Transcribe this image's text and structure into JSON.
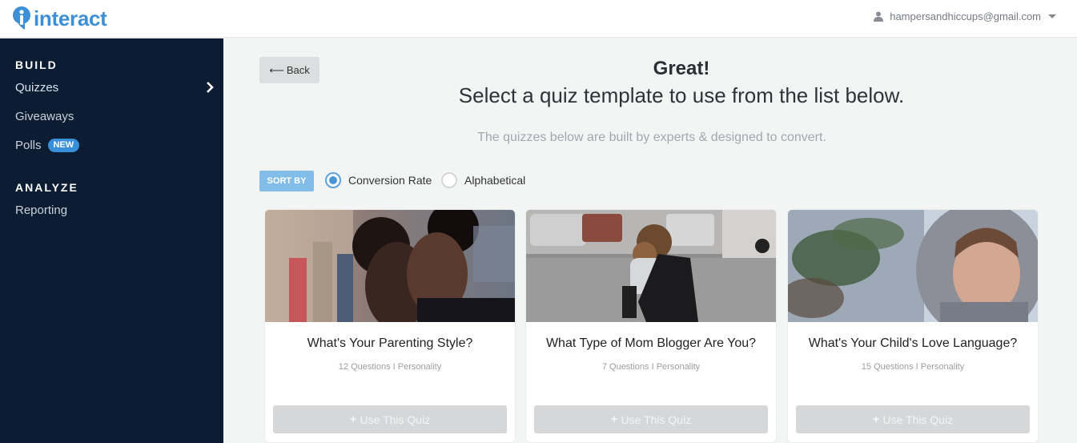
{
  "header": {
    "brand": "interact",
    "user_email": "hampersandhiccups@gmail.com"
  },
  "sidebar": {
    "sections": [
      {
        "heading": "BUILD",
        "items": [
          {
            "label": "Quizzes",
            "active": true
          },
          {
            "label": "Giveaways"
          },
          {
            "label": "Polls",
            "badge": "NEW"
          }
        ]
      },
      {
        "heading": "ANALYZE",
        "items": [
          {
            "label": "Reporting"
          }
        ]
      }
    ]
  },
  "main": {
    "back_label": "Back",
    "title": "Great!",
    "subtitle": "Select a quiz template to use from the list below.",
    "note": "The quizzes below are built by experts & designed to convert.",
    "sort": {
      "label": "SORT BY",
      "options": [
        {
          "label": "Conversion Rate",
          "selected": true
        },
        {
          "label": "Alphabetical",
          "selected": false
        }
      ]
    },
    "cards": [
      {
        "title": "What's Your Parenting Style?",
        "meta": "12 Questions I Personality",
        "button": "Use This Quiz",
        "image": "mother-daughter-kiss-photo"
      },
      {
        "title": "What Type of Mom Blogger Are You?",
        "meta": "7 Questions I Personality",
        "button": "Use This Quiz",
        "image": "mom-holding-child-street-photo"
      },
      {
        "title": "What's Your Child's Love Language?",
        "meta": "15 Questions I Personality",
        "button": "Use This Quiz",
        "image": "child-in-snow-hood-photo"
      }
    ]
  },
  "colors": {
    "brand": "#3d8fd6",
    "sidebar_bg": "#0c1d33",
    "badge": "#3a8fd9",
    "sort_button": "#82bde9"
  }
}
